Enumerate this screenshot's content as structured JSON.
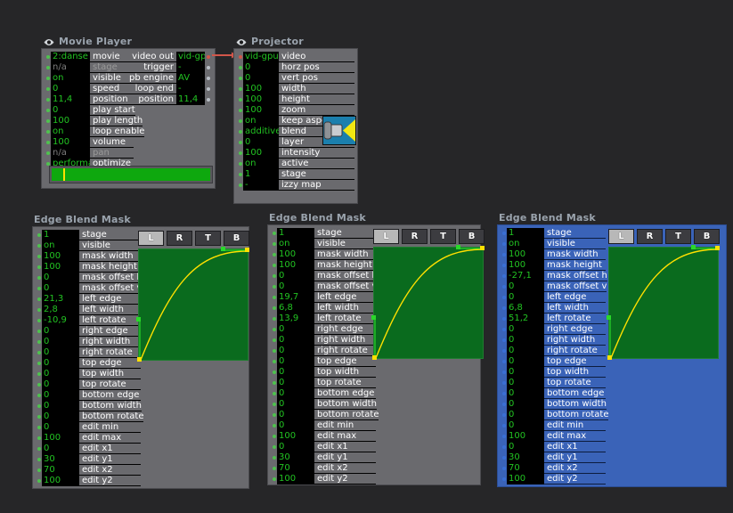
{
  "movie_player": {
    "title": "Movie Player",
    "icon": "eye-icon",
    "left_rows": [
      {
        "value": "2:danse",
        "label": "movie",
        "dim": false,
        "label_dim": false
      },
      {
        "value": "n/a",
        "label": "stage",
        "dim": true,
        "label_dim": true
      },
      {
        "value": "on",
        "label": "visible",
        "dim": false,
        "label_dim": false
      },
      {
        "value": "0",
        "label": "speed",
        "dim": false,
        "label_dim": false
      },
      {
        "value": "11,4",
        "label": "position",
        "dim": false,
        "label_dim": false
      },
      {
        "value": "0",
        "label": "play start",
        "dim": false,
        "label_dim": false
      },
      {
        "value": "100",
        "label": "play length",
        "dim": false,
        "label_dim": false
      },
      {
        "value": "on",
        "label": "loop enable",
        "dim": false,
        "label_dim": false
      },
      {
        "value": "100",
        "label": "volume",
        "dim": false,
        "label_dim": false
      },
      {
        "value": "n/a",
        "label": "pan",
        "dim": true,
        "label_dim": true
      },
      {
        "value": "performa",
        "label": "optimize",
        "dim": false,
        "label_dim": false
      }
    ],
    "right_rows": [
      {
        "label": "video out",
        "value": "vid-gpu",
        "linked": true
      },
      {
        "label": "trigger",
        "value": "-",
        "linked": false
      },
      {
        "label": "pb engine",
        "value": "AV",
        "linked": false
      },
      {
        "label": "loop end",
        "value": "-",
        "linked": false
      },
      {
        "label": "position",
        "value": "11,4",
        "linked": false
      }
    ],
    "scrub": {
      "fill_percent": 100,
      "playhead_percent": 7.5
    }
  },
  "projector": {
    "title": "Projector",
    "icon": "eye-icon",
    "rows": [
      {
        "value": "vid-gpu",
        "label": "video"
      },
      {
        "value": "0",
        "label": "horz pos"
      },
      {
        "value": "0",
        "label": "vert pos"
      },
      {
        "value": "100",
        "label": "width"
      },
      {
        "value": "100",
        "label": "height"
      },
      {
        "value": "100",
        "label": "zoom"
      },
      {
        "value": "on",
        "label": "keep aspect"
      },
      {
        "value": "additive",
        "label": "blend"
      },
      {
        "value": "0",
        "label": "layer"
      },
      {
        "value": "100",
        "label": "intensity"
      },
      {
        "value": "on",
        "label": "active"
      },
      {
        "value": "1",
        "label": "stage"
      },
      {
        "value": "-",
        "label": "izzy map"
      }
    ],
    "icon_name": "projector-icon"
  },
  "edge_blend_masks": [
    {
      "title": "Edge Blend Mask",
      "selected": false,
      "tabs": [
        {
          "label": "L",
          "active": true
        },
        {
          "label": "R",
          "active": false
        },
        {
          "label": "T",
          "active": false
        },
        {
          "label": "B",
          "active": false
        }
      ],
      "rows": [
        {
          "value": "1",
          "label": "stage"
        },
        {
          "value": "on",
          "label": "visible"
        },
        {
          "value": "100",
          "label": "mask width"
        },
        {
          "value": "100",
          "label": "mask height"
        },
        {
          "value": "0",
          "label": "mask offset h"
        },
        {
          "value": "0",
          "label": "mask offset v"
        },
        {
          "value": "21,3",
          "label": "left edge"
        },
        {
          "value": "2,8",
          "label": "left width"
        },
        {
          "value": "-10,9",
          "label": "left rotate"
        },
        {
          "value": "0",
          "label": "right edge"
        },
        {
          "value": "0",
          "label": "right width"
        },
        {
          "value": "0",
          "label": "right rotate"
        },
        {
          "value": "0",
          "label": "top edge"
        },
        {
          "value": "0",
          "label": "top width"
        },
        {
          "value": "0",
          "label": "top rotate"
        },
        {
          "value": "0",
          "label": "bottom edge"
        },
        {
          "value": "0",
          "label": "bottom width"
        },
        {
          "value": "0",
          "label": "bottom rotate"
        },
        {
          "value": "0",
          "label": "edit min"
        },
        {
          "value": "100",
          "label": "edit max"
        },
        {
          "value": "0",
          "label": "edit x1"
        },
        {
          "value": "30",
          "label": "edit y1"
        },
        {
          "value": "70",
          "label": "edit x2"
        },
        {
          "value": "100",
          "label": "edit y2"
        }
      ]
    },
    {
      "title": "Edge Blend Mask",
      "selected": false,
      "tabs": [
        {
          "label": "L",
          "active": true
        },
        {
          "label": "R",
          "active": false
        },
        {
          "label": "T",
          "active": false
        },
        {
          "label": "B",
          "active": false
        }
      ],
      "rows": [
        {
          "value": "1",
          "label": "stage"
        },
        {
          "value": "on",
          "label": "visible"
        },
        {
          "value": "100",
          "label": "mask width"
        },
        {
          "value": "100",
          "label": "mask height"
        },
        {
          "value": "0",
          "label": "mask offset h"
        },
        {
          "value": "0",
          "label": "mask offset v"
        },
        {
          "value": "19,7",
          "label": "left edge"
        },
        {
          "value": "6,8",
          "label": "left width"
        },
        {
          "value": "13,9",
          "label": "left rotate"
        },
        {
          "value": "0",
          "label": "right edge"
        },
        {
          "value": "0",
          "label": "right width"
        },
        {
          "value": "0",
          "label": "right rotate"
        },
        {
          "value": "0",
          "label": "top edge"
        },
        {
          "value": "0",
          "label": "top width"
        },
        {
          "value": "0",
          "label": "top rotate"
        },
        {
          "value": "0",
          "label": "bottom edge"
        },
        {
          "value": "0",
          "label": "bottom width"
        },
        {
          "value": "0",
          "label": "bottom rotate"
        },
        {
          "value": "0",
          "label": "edit min"
        },
        {
          "value": "100",
          "label": "edit max"
        },
        {
          "value": "0",
          "label": "edit x1"
        },
        {
          "value": "30",
          "label": "edit y1"
        },
        {
          "value": "70",
          "label": "edit x2"
        },
        {
          "value": "100",
          "label": "edit y2"
        }
      ]
    },
    {
      "title": "Edge Blend Mask",
      "selected": true,
      "tabs": [
        {
          "label": "L",
          "active": true
        },
        {
          "label": "R",
          "active": false
        },
        {
          "label": "T",
          "active": false
        },
        {
          "label": "B",
          "active": false
        }
      ],
      "rows": [
        {
          "value": "1",
          "label": "stage"
        },
        {
          "value": "on",
          "label": "visible"
        },
        {
          "value": "100",
          "label": "mask width"
        },
        {
          "value": "100",
          "label": "mask height"
        },
        {
          "value": "-27,1",
          "label": "mask offset h"
        },
        {
          "value": "0",
          "label": "mask offset v"
        },
        {
          "value": "0",
          "label": "left edge"
        },
        {
          "value": "6,8",
          "label": "left width"
        },
        {
          "value": "51,2",
          "label": "left rotate"
        },
        {
          "value": "0",
          "label": "right edge"
        },
        {
          "value": "0",
          "label": "right width"
        },
        {
          "value": "0",
          "label": "right rotate"
        },
        {
          "value": "0",
          "label": "top edge"
        },
        {
          "value": "0",
          "label": "top width"
        },
        {
          "value": "0",
          "label": "top rotate"
        },
        {
          "value": "0",
          "label": "bottom edge"
        },
        {
          "value": "0",
          "label": "bottom width"
        },
        {
          "value": "0",
          "label": "bottom rotate"
        },
        {
          "value": "0",
          "label": "edit min"
        },
        {
          "value": "100",
          "label": "edit max"
        },
        {
          "value": "0",
          "label": "edit x1"
        },
        {
          "value": "30",
          "label": "edit y1"
        },
        {
          "value": "70",
          "label": "edit x2"
        },
        {
          "value": "100",
          "label": "edit y2"
        }
      ]
    }
  ],
  "curve": {
    "description": "edit curve: ease-out from bottom-left to top-right",
    "points": [
      [
        0,
        0
      ],
      [
        30,
        0
      ],
      [
        70,
        100
      ],
      [
        100,
        100
      ]
    ],
    "handle_left_y_percent": 62,
    "handle_right_x_percent": 76
  },
  "colors": {
    "canvas": "#262628",
    "panel": "#6a6a6e",
    "panel_selected": "#3a63b8",
    "value_text": "#22c322",
    "value_bg": "#000000",
    "label_text": "#ffffff",
    "title_text": "#9aa3ad",
    "graph_fill": "#0a6b1e",
    "curve": "#ffe000",
    "scrub_fill": "#0ea80e",
    "link_wire": "#d2564a"
  }
}
